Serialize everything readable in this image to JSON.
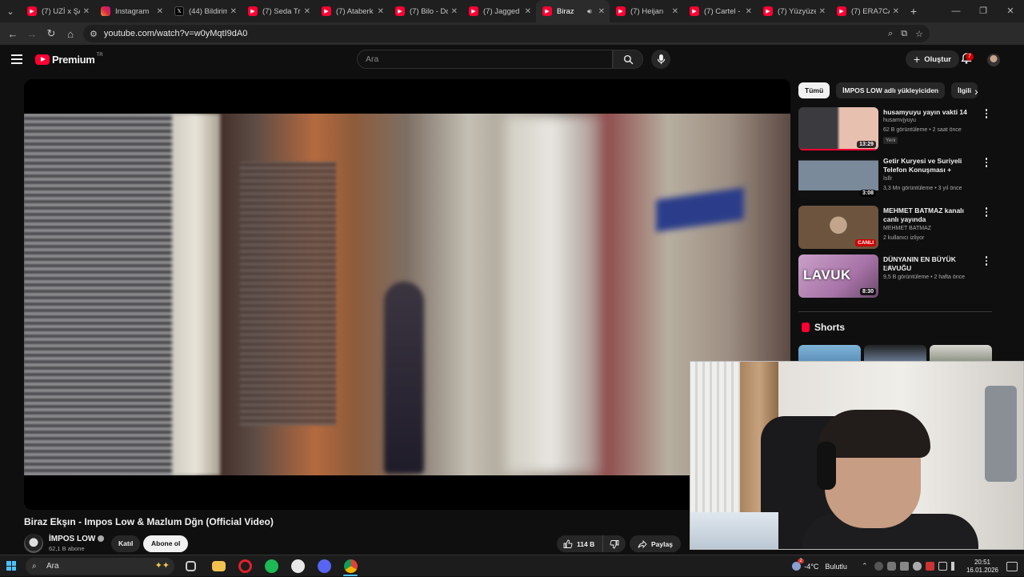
{
  "browser": {
    "tabs": [
      {
        "title": "(7) UZİ x ŞAF",
        "favicon": "youtube-icon"
      },
      {
        "title": "Instagram",
        "favicon": "instagram-icon"
      },
      {
        "title": "(44) Bildirim",
        "favicon": "x-icon"
      },
      {
        "title": "(7) Seda Tri",
        "favicon": "youtube-icon"
      },
      {
        "title": "(7) Ataberk",
        "favicon": "youtube-icon"
      },
      {
        "title": "(7) Bilo - Do",
        "favicon": "youtube-icon"
      },
      {
        "title": "(7) Jagged",
        "favicon": "youtube-icon"
      },
      {
        "title": "Biraz",
        "favicon": "youtube-icon",
        "active": true
      },
      {
        "title": "(7) Heijan",
        "favicon": "youtube-icon"
      },
      {
        "title": "(7) Cartel -",
        "favicon": "youtube-icon"
      },
      {
        "title": "(7) Yüzyüze",
        "favicon": "youtube-icon"
      },
      {
        "title": "(7) ERA7CAP",
        "favicon": "youtube-icon"
      }
    ],
    "url": "youtube.com/watch?v=w0yMqtI9dA0"
  },
  "masthead": {
    "logo_text": "Premium",
    "country": "TR",
    "search_placeholder": "Ara",
    "create_label": "Oluştur",
    "notification_count": "7"
  },
  "video": {
    "title": "Biraz Ekşın - Impos Low & Mazlum Dğn (Official Video)",
    "channel_name": "İMPOS LOW",
    "subscribers": "62,1 B abone",
    "join_label": "Katıl",
    "subscribe_label": "Abone ol",
    "likes": "114 B",
    "share_label": "Paylaş"
  },
  "sidebar": {
    "chips": [
      "Tümü",
      "İMPOS LOW adlı yükleyiciden",
      "İlgili"
    ],
    "recommendations": [
      {
        "title": "husamyuyu yayın vakti 14",
        "channel": "husamvjyuyu",
        "meta": "62 B görüntüleme • 2 saat önce",
        "badge": "Yeni",
        "duration": "13:29",
        "thumb": "t1"
      },
      {
        "title": "Getir Kuryesi ve Suriyeli Telefon Konuşması + whatsapp (uzun ...",
        "channel": "İslîr",
        "meta": "3,3 Mn görüntüleme • 3 yıl önce",
        "duration": "3:08",
        "thumb": "t2"
      },
      {
        "title": "MEHMET BATMAZ kanalı canlı yayında",
        "channel": "MEHMET BATMAZ",
        "meta": "2 kullanıcı izliyor",
        "live_label": "CANLI",
        "thumb": "t3"
      },
      {
        "title": "DÜNYANIN EN BÜYÜK LAVUĞU",
        "channel": "yuki",
        "meta": "9,5 B görüntüleme • 2 hafta önce",
        "duration": "8:30",
        "thumb": "t4",
        "thumb_text": "LAVUK"
      }
    ],
    "shorts_title": "Shorts"
  },
  "taskbar": {
    "search_placeholder": "Ara",
    "weather_temp": "-4°C",
    "weather_desc": "Bulutlu",
    "weather_badge": "2",
    "time": "20:51",
    "date": "16.01.2026"
  },
  "colors": {
    "youtube_red": "#ff0033",
    "background": "#0f0f0f",
    "chip": "#272727",
    "windows_accent": "#4cc2ff"
  }
}
